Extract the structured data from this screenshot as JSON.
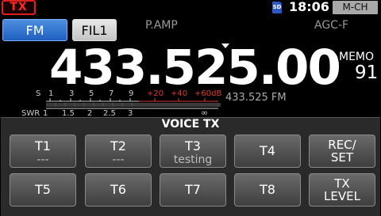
{
  "status": {
    "tx_label": "TX",
    "sd_label": "SD",
    "time": "18:06",
    "channel_mode": "M-CH"
  },
  "mode_bar": {
    "mode": "FM",
    "filter": "FIL1",
    "preamp": "P.AMP",
    "agc": "AGC-F"
  },
  "frequency": {
    "main": "433.525.00",
    "sub": "433.525 FM"
  },
  "memo": {
    "label": "MEMO",
    "number": "91"
  },
  "meter": {
    "s_label": "S",
    "s_ticks": [
      "1",
      "3",
      "5",
      "7",
      "9"
    ],
    "plus_ticks": [
      "+20",
      "+40",
      "+60dB"
    ],
    "swr_label": "SWR",
    "swr_ticks": [
      "1",
      "1.5",
      "2",
      "2.5",
      "3"
    ],
    "swr_inf": "∞"
  },
  "voice_tx": {
    "title": "VOICE TX",
    "keys": [
      {
        "main": "T1",
        "sub": "---"
      },
      {
        "main": "T2",
        "sub": "---"
      },
      {
        "main": "T3",
        "sub": "testing"
      },
      {
        "main": "T4",
        "sub": ""
      },
      {
        "main": "REC/\nSET",
        "sub": ""
      },
      {
        "main": "T5",
        "sub": ""
      },
      {
        "main": "T6",
        "sub": ""
      },
      {
        "main": "T7",
        "sub": ""
      },
      {
        "main": "T8",
        "sub": ""
      },
      {
        "main": "TX\nLEVEL",
        "sub": ""
      }
    ]
  },
  "colors": {
    "tx_red": "#ff2a20",
    "fm_blue": "#1d5fc0",
    "meter_red": "#e03a2a"
  }
}
